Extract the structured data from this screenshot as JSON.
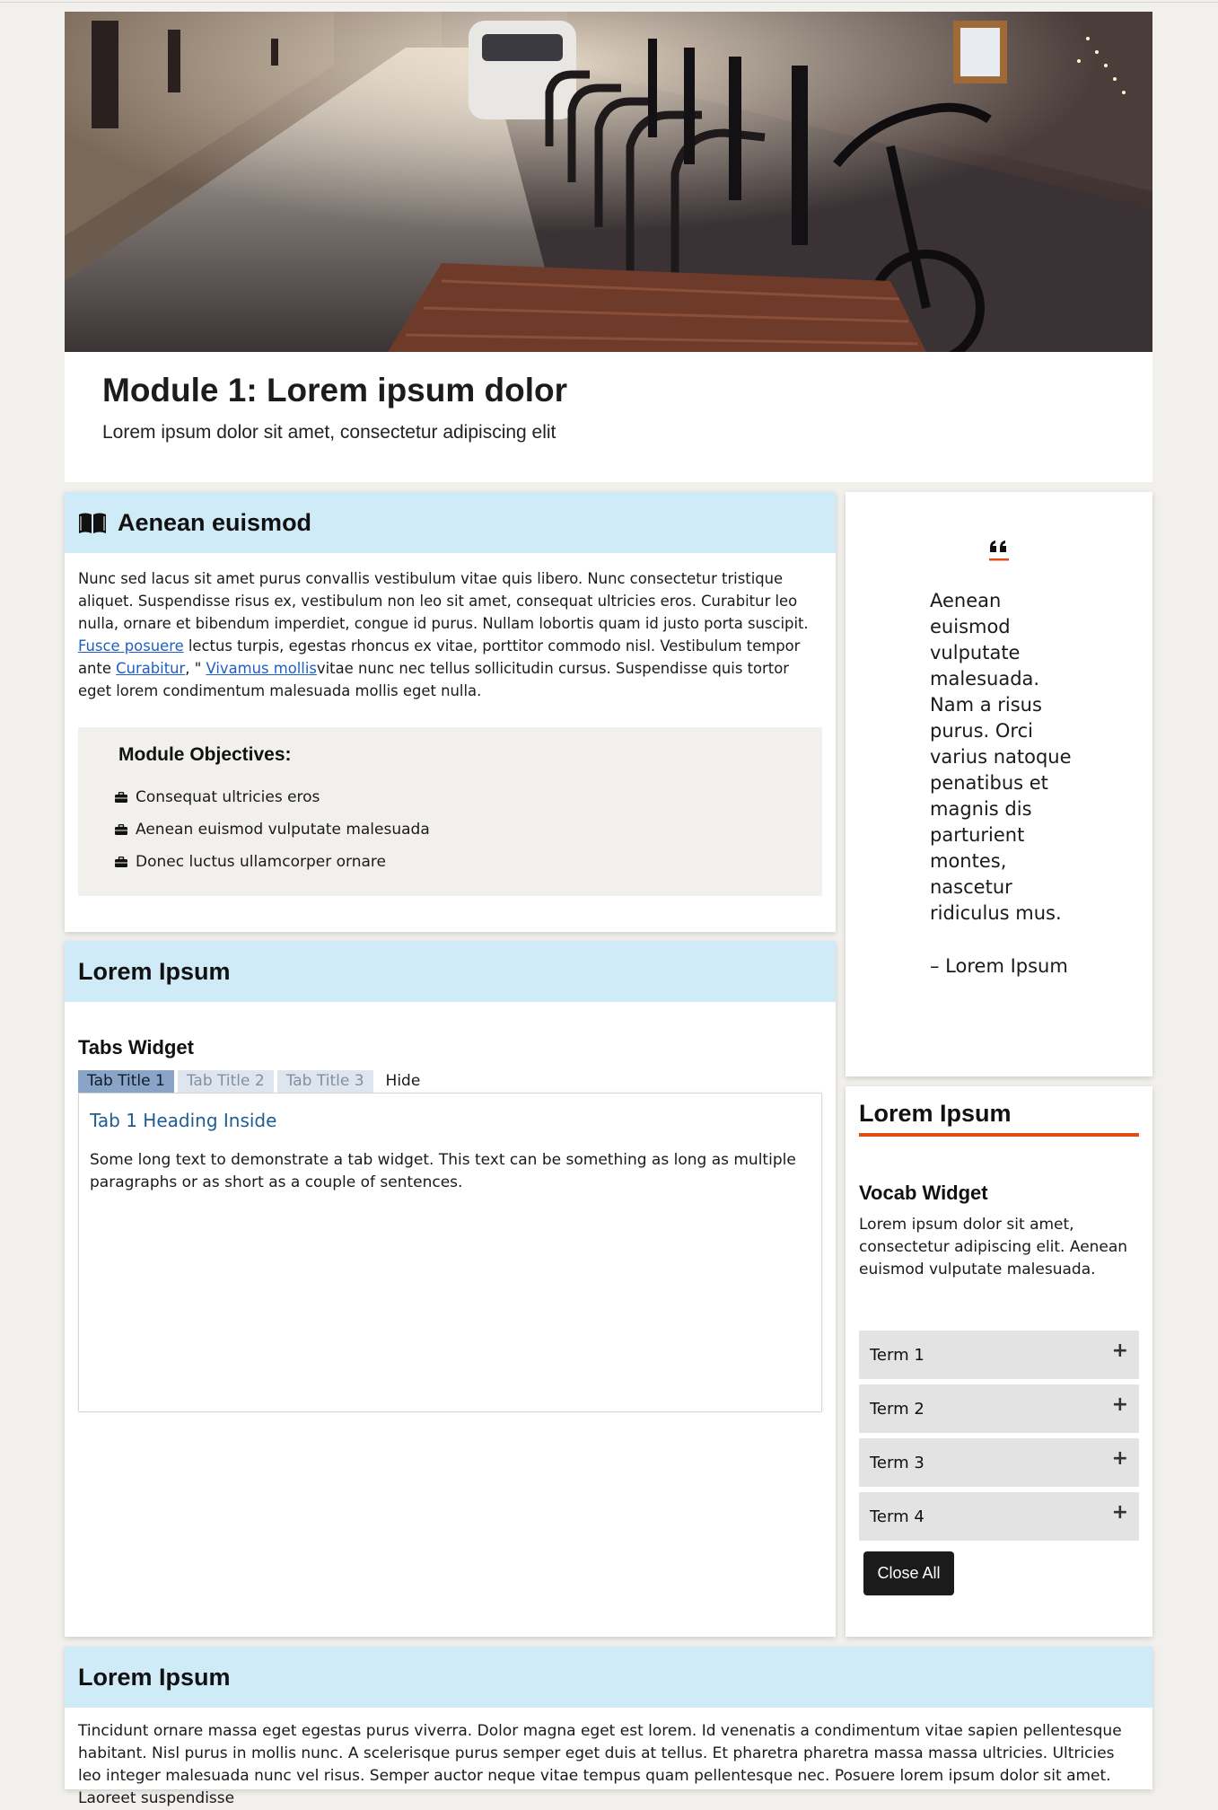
{
  "header": {
    "title": "Module 1: Lorem ipsum dolor",
    "subtitle": "Lorem ipsum dolor sit amet, consectetur adipiscing elit"
  },
  "intro_card": {
    "heading": "Aenean euismod",
    "icon": "book-open-icon",
    "paragraph_part1": "Nunc sed lacus sit amet purus convallis vestibulum vitae quis libero. Nunc consectetur tristique aliquet. Suspendisse risus ex, vestibulum non leo sit amet, consequat ultricies eros. Curabitur leo nulla, ornare et bibendum imperdiet, congue id purus. Nullam lobortis quam id justo porta suscipit. ",
    "link1": "Fusce posuere",
    "paragraph_part2": " lectus turpis, egestas rhoncus ex vitae, porttitor commodo nisl. Vestibulum tempor ante ",
    "link2": "Curabitur",
    "paragraph_part3": ", \" ",
    "link3": "Vivamus mollis",
    "paragraph_part4": "vitae nunc nec tellus sollicitudin cursus. Suspendisse quis tortor eget lorem condimentum malesuada mollis eget nulla.",
    "objectives": {
      "title": "Module Objectives:",
      "items": [
        "Consequat ultricies eros",
        "Aenean euismod vulputate malesuada",
        "Donec luctus ullamcorper ornare"
      ]
    }
  },
  "quote_card": {
    "text": "Aenean\neuismod\nvulputate\nmalesuada.\nNam a risus\npurus. Orci\nvarius natoque\npenatibus et\nmagnis dis\nparturient\nmontes,\nnascetur\nridiculus mus.",
    "attribution": "– Lorem Ipsum"
  },
  "tabs_card": {
    "heading": "Lorem Ipsum",
    "widget_title": "Tabs Widget",
    "tabs": [
      "Tab Title 1",
      "Tab Title 2",
      "Tab Title 3"
    ],
    "hide_label": "Hide",
    "panel_heading": "Tab 1 Heading Inside",
    "panel_text": "Some long text to demonstrate a tab widget. This text can be something as long as multiple paragraphs or as short as a couple of sentences."
  },
  "vocab_card": {
    "heading": "Lorem Ipsum",
    "widget_title": "Vocab Widget",
    "description": "Lorem ipsum dolor sit amet, consectetur adipiscing elit. Aenean euismod vulputate malesuada.",
    "terms": [
      "Term 1",
      "Term 2",
      "Term 3",
      "Term 4"
    ],
    "close_all_label": "Close All"
  },
  "bottom_card": {
    "heading": "Lorem Ipsum",
    "text": "Tincidunt ornare massa eget egestas purus viverra. Dolor magna eget est lorem. Id venenatis a condimentum vitae sapien pellentesque habitant. Nisl purus in mollis nunc. A scelerisque purus semper eget duis at tellus. Et pharetra pharetra massa massa ultricies. Ultricies leo integer malesuada nunc vel risus. Semper auctor neque vitae tempus quam pellentesque nec. Posuere lorem ipsum dolor sit amet. Laoreet suspendisse"
  },
  "colors": {
    "card_header_bg": "#d0ebf8",
    "accent_orange": "#e04e1c",
    "link_blue": "#1f5fc4",
    "tab_active_bg": "#8aa4c8",
    "page_bg": "#f2f0ec"
  }
}
